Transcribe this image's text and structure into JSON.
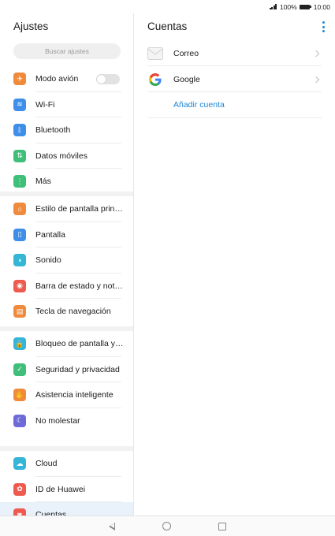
{
  "status": {
    "battery": "100%",
    "time": "10:00"
  },
  "settings": {
    "title": "Ajustes",
    "search_placeholder": "Buscar ajustes",
    "groups": [
      [
        {
          "label": "Modo avión",
          "icon": "airplane-icon",
          "color": "#f08a3c",
          "glyph": "✈"
        },
        {
          "label": "Wi-Fi",
          "icon": "wifi-icon",
          "color": "#3f8ee8",
          "glyph": "≋"
        },
        {
          "label": "Bluetooth",
          "icon": "bluetooth-icon",
          "color": "#3f8ee8",
          "glyph": "ᛒ"
        },
        {
          "label": "Datos móviles",
          "icon": "mobile-data-icon",
          "color": "#3fbf7a",
          "glyph": "⇅"
        },
        {
          "label": "Más",
          "icon": "more-icon",
          "color": "#3fbf7a",
          "glyph": "⋮"
        }
      ],
      [
        {
          "label": "Estilo de pantalla principal",
          "icon": "home-style-icon",
          "color": "#f08a3c",
          "glyph": "⌂"
        },
        {
          "label": "Pantalla",
          "icon": "display-icon",
          "color": "#3f8ee8",
          "glyph": "▯"
        },
        {
          "label": "Sonido",
          "icon": "sound-icon",
          "color": "#35b6d6",
          "glyph": "◖"
        },
        {
          "label": "Barra de estado y notificaciones",
          "icon": "notifications-icon",
          "color": "#ee5a4f",
          "glyph": "◉"
        },
        {
          "label": "Tecla de navegación",
          "icon": "navigation-key-icon",
          "color": "#f08a3c",
          "glyph": "▤"
        }
      ],
      [
        {
          "label": "Bloqueo de pantalla y contraseñas",
          "icon": "lock-icon",
          "color": "#35b6d6",
          "glyph": "🔒"
        },
        {
          "label": "Seguridad y privacidad",
          "icon": "shield-icon",
          "color": "#3fbf7a",
          "glyph": "✓"
        },
        {
          "label": "Asistencia inteligente",
          "icon": "hand-icon",
          "color": "#f08a3c",
          "glyph": "✋"
        },
        {
          "label": "No molestar",
          "icon": "moon-icon",
          "color": "#6e6ad8",
          "glyph": "☾"
        }
      ],
      [
        {
          "label": "Cloud",
          "icon": "cloud-icon",
          "color": "#35b6d6",
          "glyph": "☁"
        },
        {
          "label": "ID de Huawei",
          "icon": "huawei-icon",
          "color": "#ee5a4f",
          "glyph": "✿"
        },
        {
          "label": "Cuentas",
          "icon": "accounts-icon",
          "color": "#ee5a4f",
          "glyph": "◙"
        }
      ]
    ]
  },
  "accounts": {
    "title": "Cuentas",
    "items": [
      {
        "label": "Correo",
        "icon": "mail-icon"
      },
      {
        "label": "Google",
        "icon": "google-icon"
      }
    ],
    "add_label": "Añadir cuenta"
  }
}
